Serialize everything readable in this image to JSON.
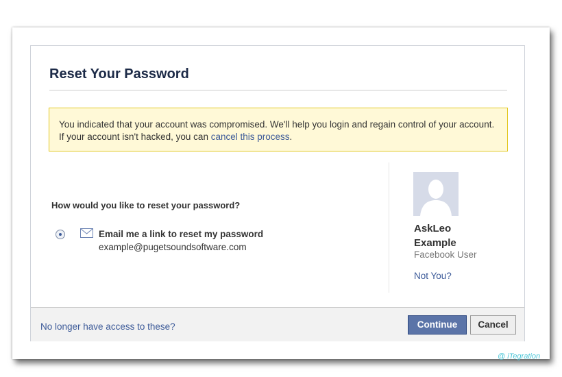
{
  "dialog": {
    "title": "Reset Your Password",
    "notice": {
      "text": "You indicated that your account was compromised. We'll help you login and regain control of your account. If your account isn't hacked, you can",
      "link": "cancel this process",
      "suffix": "."
    },
    "question": "How would you like to reset your password?",
    "option": {
      "label": "Email me a link to reset my password",
      "email": "example@pugetsoundsoftware.com",
      "selected": true
    },
    "user": {
      "name": "AskLeo Example",
      "subtitle": "Facebook User",
      "not_you": "Not You?"
    },
    "footer": {
      "link": "No longer have access to these?",
      "continue": "Continue",
      "cancel": "Cancel"
    }
  },
  "watermark": "@ iTegration",
  "colors": {
    "brand": "#3b5998",
    "notice_bg": "#fff9d7",
    "notice_border": "#e2c822",
    "continue_bg": "#5b74a8"
  }
}
